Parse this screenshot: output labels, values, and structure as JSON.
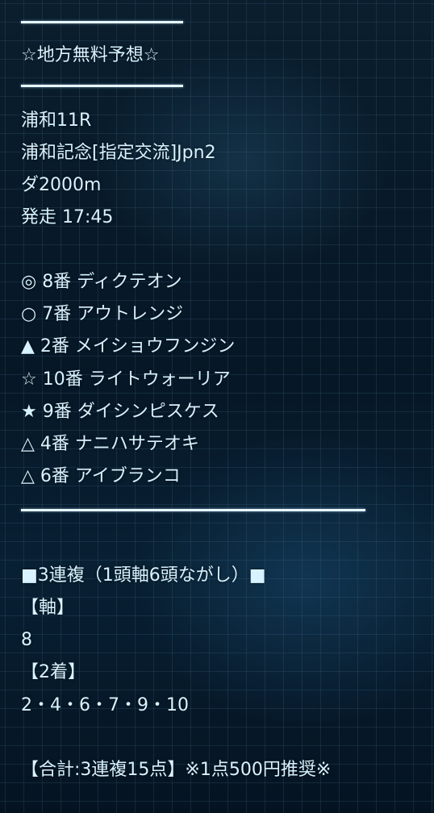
{
  "header": {
    "title": "☆地方無料予想☆"
  },
  "race": {
    "venue_race": "浦和11R",
    "race_name": "浦和記念[指定交流]Jpn2",
    "distance": "ダ2000m",
    "post_time": "発走 17:45"
  },
  "picks": [
    "◎ 8番 ディクテオン",
    "○ 7番 アウトレンジ",
    "▲ 2番 メイショウフンジン",
    "☆ 10番 ライトウォーリア",
    "★ 9番 ダイシンピスケス",
    "△ 4番 ナニハサテオキ",
    "△ 6番 アイブランコ"
  ],
  "bet": {
    "type": "■3連複（1頭軸6頭ながし）■",
    "axis_label": "【軸】",
    "axis_value": "8",
    "second_label": "【2着】",
    "second_value": "2・4・6・7・9・10",
    "total": "【合計:3連複15点】※1点500円推奨※"
  }
}
